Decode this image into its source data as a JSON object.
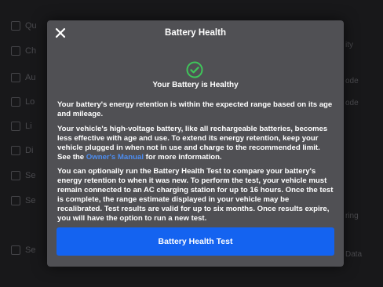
{
  "modal": {
    "title": "Battery Health",
    "status": "Your Battery is Healthy",
    "paragraph1": "Your battery's energy retention is within the expected range based on its age and mileage.",
    "paragraph2_before_link": "Your vehicle's high-voltage battery, like all rechargeable batteries, becomes less effective with age and use. To extend its energy retention, keep your vehicle plugged in when not in use and charge to the recommended limit. See the ",
    "paragraph2_link": "Owner's Manual",
    "paragraph2_after_link": " for more information.",
    "paragraph3": "You can optionally run the Battery Health Test to compare your battery's energy retention to when it was new. To perform the test, your vehicle must remain connected to an AC charging station for up to 16 hours. Once the test is complete, the range estimate displayed in your vehicle may be recalibrated. Test results are valid for up to six months. Once results expire, you will have the option to run a new test.",
    "button_label": "Battery Health Test",
    "close_icon": "close-icon",
    "status_icon": "check-circle-icon"
  },
  "background": {
    "left_items": [
      "Qu",
      "Ch",
      "Au",
      "Lo",
      "Li",
      "Di",
      "Se",
      "Se",
      "Se"
    ],
    "right_items": [
      "ity",
      "ode",
      "ode",
      "ring",
      "Data"
    ]
  },
  "colors": {
    "modal_bg": "#505054",
    "accent_blue": "#1463f0",
    "link_blue": "#4d8df0",
    "check_green": "#3fc55a"
  }
}
